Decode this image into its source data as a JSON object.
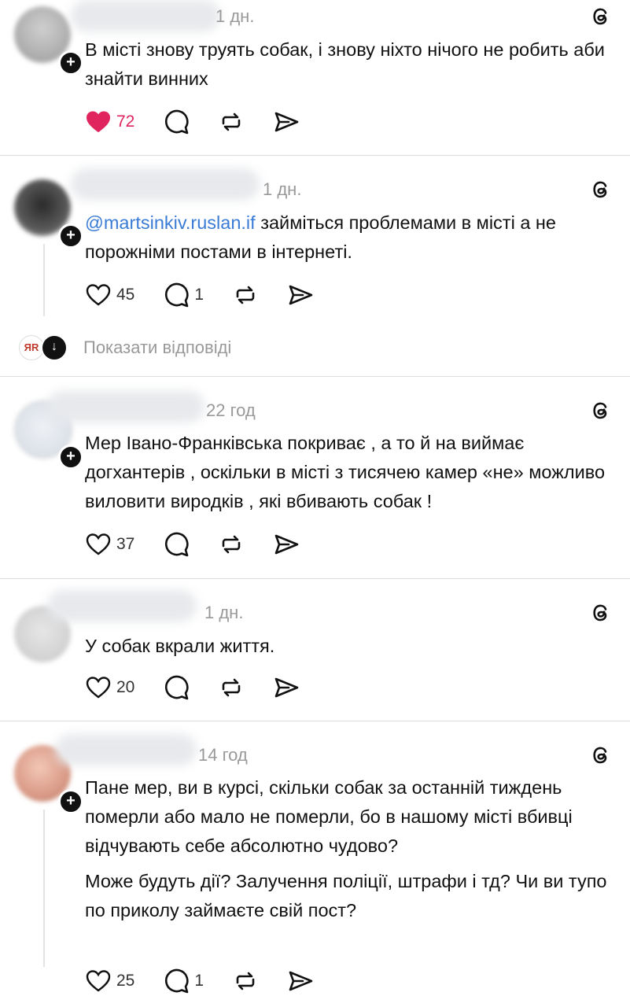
{
  "posts": [
    {
      "time": "1 дн.",
      "text": "В місті знову труять собак, і знову ніхто нічого не робить аби знайти винних",
      "likes": "72",
      "liked": true,
      "replies": ""
    },
    {
      "time": "1 дн.",
      "mention": "@martsinkiv.ruslan.if",
      "text": " займіться проблемами в місті а не порожніми постами в інтернеті.",
      "likes": "45",
      "liked": false,
      "replies": "1",
      "show_replies_label": "Показати відповіді",
      "reply_avatar_text": "ЯR"
    },
    {
      "time": "22 год",
      "text": "Мер Івано-Франківська покриває , а то й на виймає догхантерів , оскільки в місті з тисячею камер «не» можливо виловити виродків , які вбивають собак !",
      "likes": "37",
      "liked": false,
      "replies": ""
    },
    {
      "time": "1 дн.",
      "text": "У собак вкрали життя.",
      "likes": "20",
      "liked": false,
      "replies": ""
    },
    {
      "time": "14 год",
      "text": "Пане мер, ви в курсі, скільки собак за останній тиждень померли або мало не померли, бо в нашому місті вбивці відчувають себе абсолютно чудово?",
      "text2": "Може будуть дії? Залучення поліції, штрафи і тд? Чи ви тупо по приколу займаєте свій пост?",
      "likes": "25",
      "liked": false,
      "replies": "1"
    }
  ],
  "icons": [
    "heart-icon",
    "comment-icon",
    "repost-icon",
    "share-icon",
    "threads-logo-icon"
  ],
  "colors": {
    "like_active": "#e0245e",
    "mention": "#3a7bd5",
    "muted": "#999999"
  }
}
